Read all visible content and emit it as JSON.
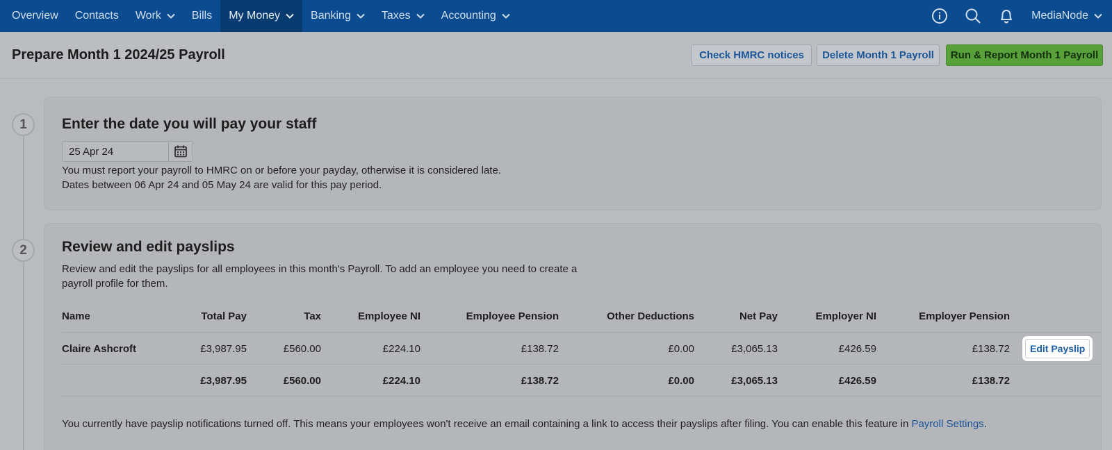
{
  "nav": {
    "items": [
      {
        "label": "Overview",
        "dropdown": false
      },
      {
        "label": "Contacts",
        "dropdown": false
      },
      {
        "label": "Work",
        "dropdown": true
      },
      {
        "label": "Bills",
        "dropdown": false
      },
      {
        "label": "My Money",
        "dropdown": true,
        "active": true
      },
      {
        "label": "Banking",
        "dropdown": true
      },
      {
        "label": "Taxes",
        "dropdown": true
      },
      {
        "label": "Accounting",
        "dropdown": true
      }
    ],
    "icons": [
      "info-icon",
      "search-icon",
      "bell-icon"
    ],
    "user": "MediaNode"
  },
  "header": {
    "title": "Prepare Month 1 2024/25 Payroll",
    "check_label": "Check HMRC notices",
    "delete_label": "Delete Month 1 Payroll",
    "run_label": "Run & Report Month 1 Payroll"
  },
  "step1": {
    "number": "1",
    "title": "Enter the date you will pay your staff",
    "date_value": "25 Apr 24",
    "line1": "You must report your payroll to HMRC on or before your payday, otherwise it is considered late.",
    "line2": "Dates between 06 Apr 24 and 05 May 24 are valid for this pay period."
  },
  "step2": {
    "number": "2",
    "title": "Review and edit payslips",
    "line1": "Review and edit the payslips for all employees in this month's Payroll. To add an employee you need to create a",
    "line2": "payroll profile for them.",
    "columns": [
      "Name",
      "Total Pay",
      "Tax",
      "Employee NI",
      "Employee Pension",
      "Other Deductions",
      "Net Pay",
      "Employer NI",
      "Employer Pension"
    ],
    "rows": [
      {
        "name": "Claire Ashcroft",
        "total_pay": "£3,987.95",
        "tax": "£560.00",
        "employee_ni": "£224.10",
        "employee_pension": "£138.72",
        "other_deductions": "£0.00",
        "net_pay": "£3,065.13",
        "employer_ni": "£426.59",
        "employer_pension": "£138.72",
        "action": "Edit Payslip"
      }
    ],
    "totals": {
      "total_pay": "£3,987.95",
      "tax": "£560.00",
      "employee_ni": "£224.10",
      "employee_pension": "£138.72",
      "other_deductions": "£0.00",
      "net_pay": "£3,065.13",
      "employer_ni": "£426.59",
      "employer_pension": "£138.72"
    },
    "notice_text": "You currently have payslip notifications turned off. This means your employees won't receive an email containing a link to access their payslips after filing. You can enable this feature in ",
    "notice_link": "Payroll Settings",
    "notice_end": "."
  },
  "colors": {
    "nav_bg": "#0a4c8f",
    "run_button": "#58a03a",
    "link": "#1a5ca6"
  }
}
